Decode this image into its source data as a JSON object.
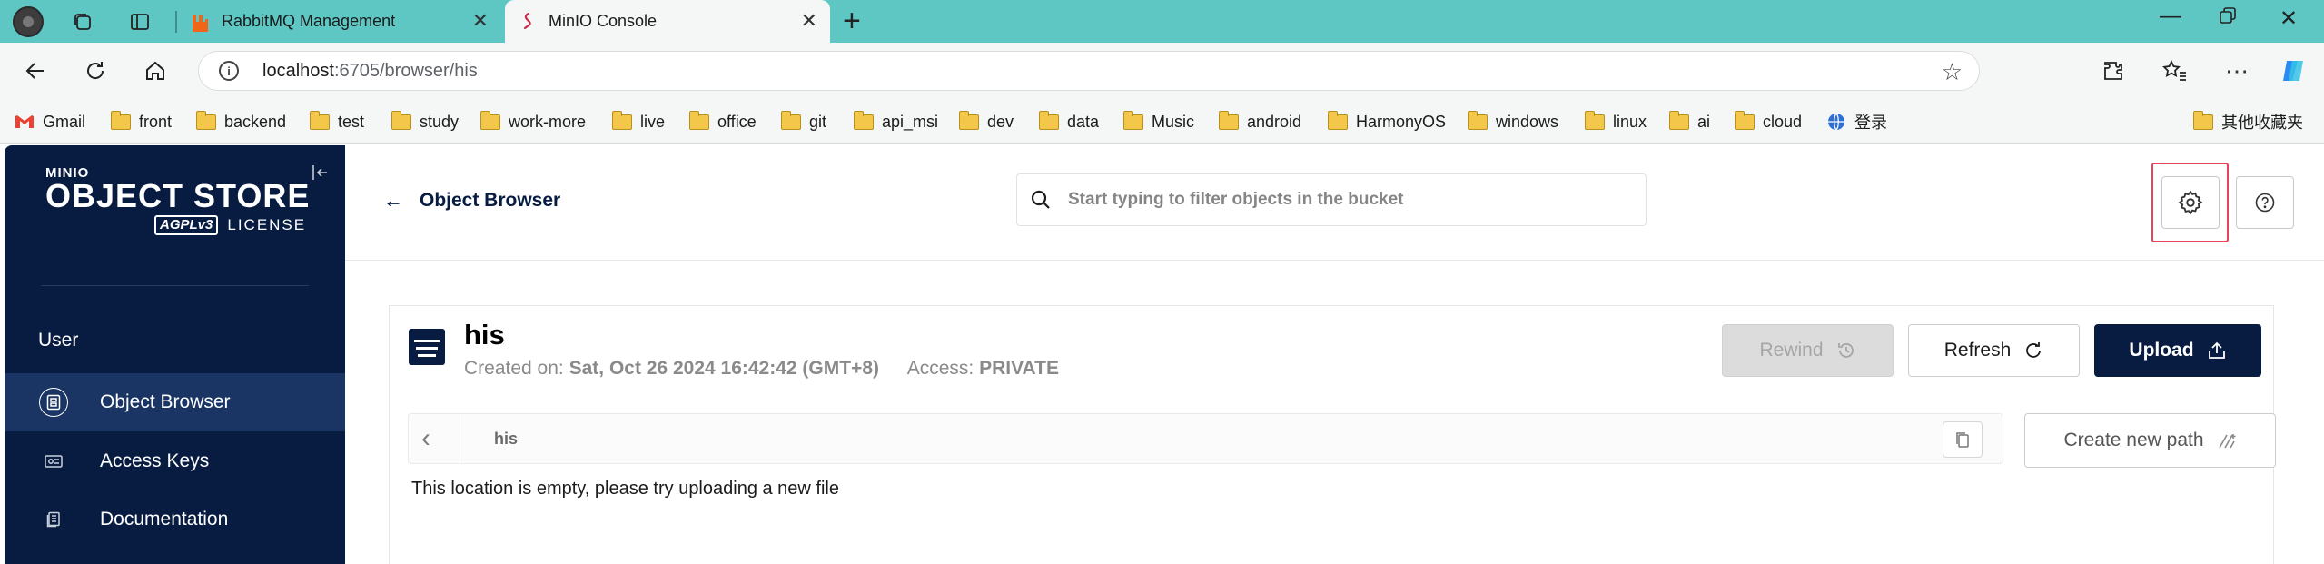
{
  "browser": {
    "tabs": [
      {
        "title": "RabbitMQ Management",
        "active": false
      },
      {
        "title": "MinIO Console",
        "active": true
      }
    ],
    "url_host": "localhost",
    "url_rest": ":6705/browser/his",
    "bookmarks": [
      {
        "label": "Gmail",
        "icon": "gmail-icon"
      },
      {
        "label": "front",
        "icon": "folder-icon"
      },
      {
        "label": "backend",
        "icon": "folder-icon"
      },
      {
        "label": "test",
        "icon": "folder-icon"
      },
      {
        "label": "study",
        "icon": "folder-icon"
      },
      {
        "label": "work-more",
        "icon": "folder-icon"
      },
      {
        "label": "live",
        "icon": "folder-icon"
      },
      {
        "label": "office",
        "icon": "folder-icon"
      },
      {
        "label": "git",
        "icon": "folder-icon"
      },
      {
        "label": "api_msi",
        "icon": "folder-icon"
      },
      {
        "label": "dev",
        "icon": "folder-icon"
      },
      {
        "label": "data",
        "icon": "folder-icon"
      },
      {
        "label": "Music",
        "icon": "folder-icon"
      },
      {
        "label": "android",
        "icon": "folder-icon"
      },
      {
        "label": "HarmonyOS",
        "icon": "folder-icon"
      },
      {
        "label": "windows",
        "icon": "folder-icon"
      },
      {
        "label": "linux",
        "icon": "folder-icon"
      },
      {
        "label": "ai",
        "icon": "folder-icon"
      },
      {
        "label": "cloud",
        "icon": "folder-icon"
      },
      {
        "label": "登录",
        "icon": "globe-icon"
      }
    ],
    "other_bookmarks": "其他收藏夹"
  },
  "sidebar": {
    "logo": {
      "brand": "MINIO",
      "product": "OBJECT STORE",
      "badge": "AGPLv3",
      "license": "LICENSE"
    },
    "section": "User",
    "items": [
      {
        "label": "Object Browser",
        "icon": "object-browser-icon",
        "active": true
      },
      {
        "label": "Access Keys",
        "icon": "access-keys-icon",
        "active": false
      },
      {
        "label": "Documentation",
        "icon": "documentation-icon",
        "active": false
      }
    ]
  },
  "header": {
    "back_label": "Object Browser",
    "search_placeholder": "Start typing to filter objects in the bucket"
  },
  "bucket": {
    "name": "his",
    "created_label": "Created on:",
    "created_value": "Sat, Oct 26 2024 16:42:42 (GMT+8)",
    "access_label": "Access:",
    "access_value": "PRIVATE"
  },
  "actions": {
    "rewind": "Rewind",
    "refresh": "Refresh",
    "upload": "Upload",
    "create_path": "Create new path"
  },
  "path": {
    "crumb": "his"
  },
  "empty_message": "This location is empty, please try uploading a new file",
  "colors": {
    "brand_navy": "#081c42",
    "highlight": "#e8435a",
    "tabbar": "#5ec7c4"
  }
}
